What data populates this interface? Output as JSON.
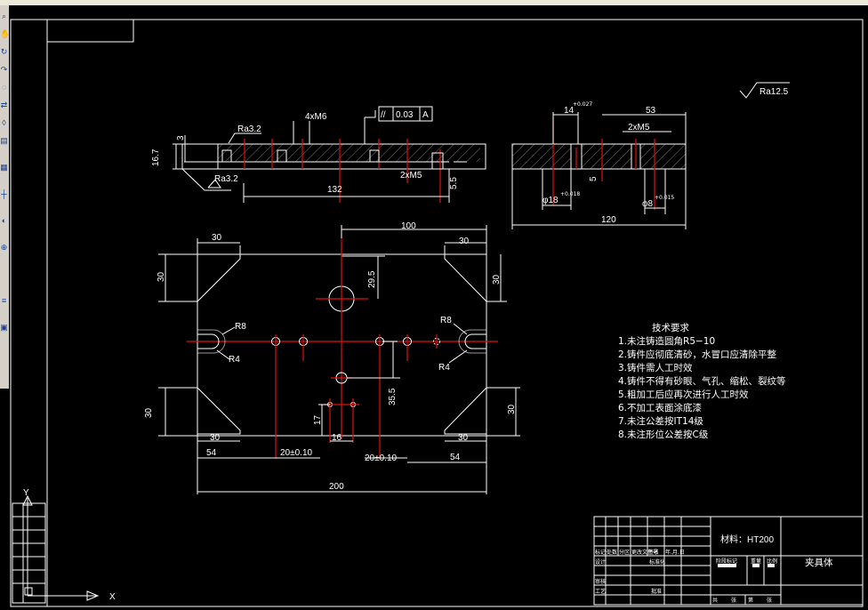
{
  "toolbar": {
    "icons": [
      "zoom-icon",
      "pan-icon",
      "rotate-icon",
      "redo-icon",
      "snap-icon",
      "match-icon",
      "select-icon",
      "print-icon",
      "grid-icon",
      "ortho-icon",
      "polar-icon",
      "osnap-icon",
      "layer-icon",
      "properties-icon"
    ]
  },
  "drawing": {
    "roughness_top": "Ra12.5",
    "side_view": {
      "height": "16.7",
      "depth": "3",
      "ra1": "Ra3.2",
      "ra2": "Ra3.2",
      "holes": "4xM6",
      "parallel_symbol": "//",
      "parallel_tol": "0.03",
      "datum": "A",
      "bottom_holes": "2xM5",
      "length": "132",
      "side_h": "5.5"
    },
    "section_view": {
      "width1": "14",
      "tol1": "+0.027\n0",
      "width2": "53",
      "holes": "2xM5",
      "depth": "5",
      "dia1": "φ18",
      "dia1_tol": "+0.018\n0",
      "dia2": "φ8",
      "dia2_tol": "+0.015\n0",
      "total": "120"
    },
    "top_view": {
      "d100": "100",
      "d30_tl": "30",
      "d30_tr": "30",
      "d30_l": "30",
      "d30_r": "30",
      "d29_5": "29.5",
      "r8_l": "R8",
      "r4_l": "R4",
      "r8_r": "R8",
      "r4_r": "R4",
      "d35_5": "35.5",
      "d17": "17",
      "d16": "16",
      "d30_bl": "30",
      "d30_br": "30",
      "d30_lb": "30",
      "d30_rb": "30",
      "d54_l": "54",
      "d20_l": "20±0.10",
      "d20_r": "20±0.10",
      "d54_r": "54",
      "d200": "200"
    },
    "requirements": {
      "title": "技术要求",
      "items": [
        "1.未注铸造圆角R5−10",
        "2.铸件应彻底清砂，水冒口应清除平整",
        "3.铸件需人工时效",
        "4.铸件不得有砂眼、气孔、缩松、裂纹等",
        "5.粗加工后应再次进行人工时效",
        "6.不加工表面涂底漆",
        "7.未注公差按IT14级",
        "8.未注形位公差按C级"
      ]
    },
    "title_block": {
      "material": "材料：HT200",
      "part_name": "夹具体",
      "labels": [
        "标记",
        "处数",
        "分区",
        "更改文件号",
        "签名",
        "年.月.日",
        "设计",
        "标准化",
        "审核",
        "工艺",
        "批准",
        "阶段标记",
        "重量",
        "比例",
        "共",
        "张",
        "第",
        "张"
      ]
    }
  }
}
